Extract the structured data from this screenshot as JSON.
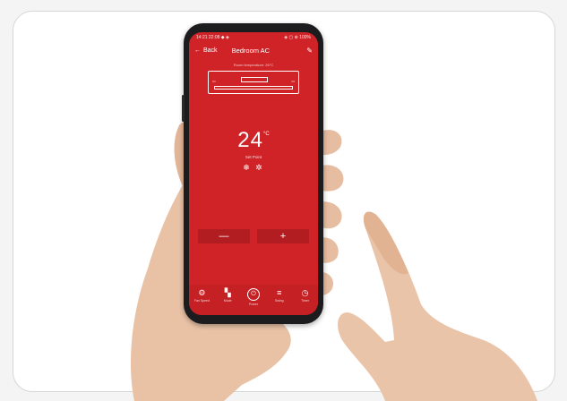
{
  "statusbar": {
    "left": "14:21  22:08 ◆ ◈",
    "right": "◈ ▢ ⊕ 100%"
  },
  "appbar": {
    "back_label": "Back",
    "title": "Bedroom AC"
  },
  "unit": {
    "room_temp_text": "Room temperature: 26°C"
  },
  "control": {
    "temperature": "24",
    "unit": "°C",
    "mode": "Set Point",
    "mode_icons": "❄ ✲"
  },
  "adjust": {
    "minus": "—",
    "plus": "+"
  },
  "tabs": [
    {
      "icon": "gear-icon",
      "glyph": "⚙",
      "label": "Fan Speed"
    },
    {
      "icon": "mode-icon",
      "glyph": "▚",
      "label": "Mode"
    },
    {
      "icon": "power-icon",
      "glyph": "⏻",
      "label": "Power"
    },
    {
      "icon": "swing-icon",
      "glyph": "≡",
      "label": "Swing"
    },
    {
      "icon": "timer-icon",
      "glyph": "◷",
      "label": "Timer"
    }
  ],
  "colors": {
    "app_red": "#cf2327",
    "button_red": "#b21d21",
    "phone": "#1c1c1e"
  }
}
